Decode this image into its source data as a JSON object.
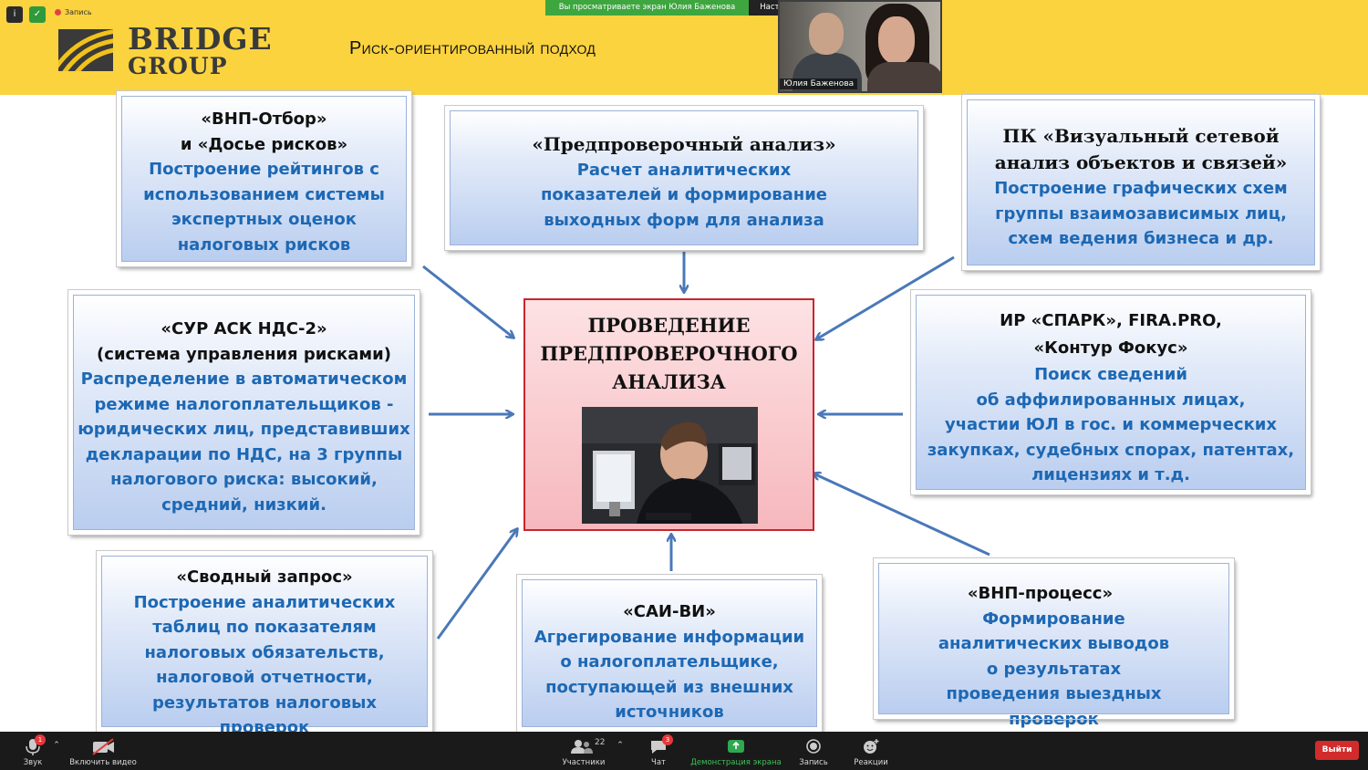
{
  "zoom": {
    "record_label": "Запись",
    "share_banner": "Вы просматриваете экран Юлия Баженова",
    "view_options": "Настройки просмотра",
    "participant_name": "Юлия Баженова",
    "toolbar": {
      "audio": "Звук",
      "audio_badge": "1",
      "video": "Включить видео",
      "participants": "Участники",
      "participants_count": "22",
      "chat": "Чат",
      "chat_badge": "3",
      "share": "Демонстрация экрана",
      "record": "Запись",
      "reactions": "Реакции",
      "exit": "Выйти"
    },
    "colors": {
      "share_green": "#3ea63f",
      "exit_red": "#d22b2b"
    }
  },
  "slide": {
    "logo_line1": "BRIDGE",
    "logo_line2": "GROUP",
    "title": "Риск-ориентированный подход",
    "center_title": "ПРОВЕДЕНИЕ ПРЕДПРОВЕРОЧНОГО АНАЛИЗА",
    "boxes": {
      "vnp_otbor": {
        "title": "«ВНП-Отбор»\nи «Досье рисков»",
        "desc": "Построение рейтингов с использованием системы экспертных оценок налоговых рисков"
      },
      "predproverka": {
        "title": "«Предпроверочный анализ»",
        "desc": "Расчет аналитических показателей и формирование выходных форм для анализа"
      },
      "vizual": {
        "title": "ПК «Визуальный сетевой анализ объектов и связей»",
        "desc": "Построение графических схем группы взаимозависимых лиц, схем ведения бизнеса и др."
      },
      "sur": {
        "title": "«СУР АСК НДС-2»\n(система управления рисками)",
        "desc": "Распределение в  автоматическом режиме налогоплательщиков - юридических лиц, представивших декларации по НДС, на 3 группы налогового риска: высокий, средний, низкий."
      },
      "spark": {
        "title": "ИР «СПАРК», FIRA.PRO,\n«Контур Фокус»",
        "desc": "Поиск сведений\nоб аффилированных лицах,\nучастии ЮЛ в гос. и коммерческих закупках, судебных спорах, патентах, лицензиях и т.д."
      },
      "svodny": {
        "title": "«Сводный запрос»",
        "desc": "Построение аналитических таблиц по показателям налоговых обязательств, налоговой отчетности, результатов налоговых проверок"
      },
      "sai": {
        "title": "«САИ-ВИ»",
        "desc": "Агрегирование информации о налогоплательщике, поступающей из внешних источников"
      },
      "vnp_process": {
        "title": "«ВНП-процесс»",
        "desc": "Формирование аналитических выводов о результатах проведения выездных проверок"
      }
    },
    "colors": {
      "header_yellow": "#fbd33f",
      "box_text_blue": "#1d68b4",
      "center_border": "#c9252d",
      "arrow_blue": "#4a78b8"
    }
  }
}
